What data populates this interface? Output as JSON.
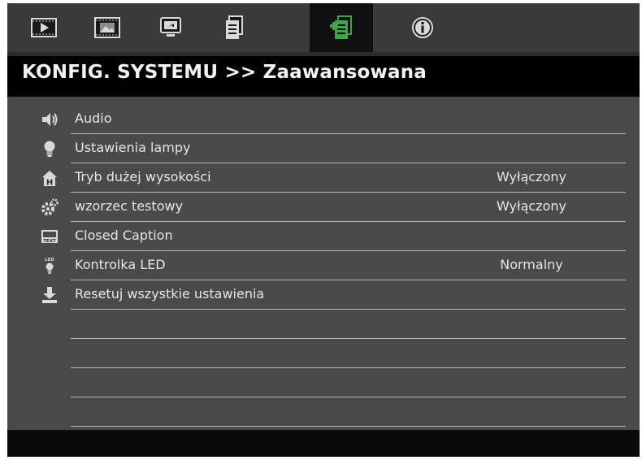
{
  "tabs": [
    {
      "name": "play-icon",
      "active": false
    },
    {
      "name": "picture-icon",
      "active": false
    },
    {
      "name": "screen-icon",
      "active": false
    },
    {
      "name": "document-icon",
      "active": false
    },
    {
      "name": "system-settings-icon",
      "active": true
    },
    {
      "name": "info-icon",
      "active": false
    }
  ],
  "header": {
    "title": "KONFIG. SYSTEMU >> Zaawansowana"
  },
  "menu": {
    "items": [
      {
        "label": "Audio",
        "value": "",
        "icon": "speaker-icon"
      },
      {
        "label": "Ustawienia lampy",
        "value": "",
        "icon": "lamp-icon"
      },
      {
        "label": "Tryb dużej wysokości",
        "value": "Wyłączony",
        "icon": "high-altitude-icon"
      },
      {
        "label": "wzorzec testowy",
        "value": "Wyłączony",
        "icon": "test-pattern-icon"
      },
      {
        "label": "Closed Caption",
        "value": "",
        "icon": "caption-text-icon"
      },
      {
        "label": "Kontrolka LED",
        "value": "Normalny",
        "icon": "led-icon"
      },
      {
        "label": "Resetuj wszystkie ustawienia",
        "value": "",
        "icon": "reset-icon"
      },
      {
        "label": "",
        "value": "",
        "icon": ""
      },
      {
        "label": "",
        "value": "",
        "icon": ""
      },
      {
        "label": "",
        "value": "",
        "icon": ""
      },
      {
        "label": "",
        "value": "",
        "icon": ""
      }
    ],
    "icon_label_text": {
      "caption": "TEXT",
      "led": "LED",
      "altitude": "H"
    }
  },
  "colors": {
    "active_tab_icon": "#3fa34d",
    "icon_gray": "#d9d9d9",
    "panel_bg": "#4a4a4a",
    "title_bg": "#000000"
  }
}
